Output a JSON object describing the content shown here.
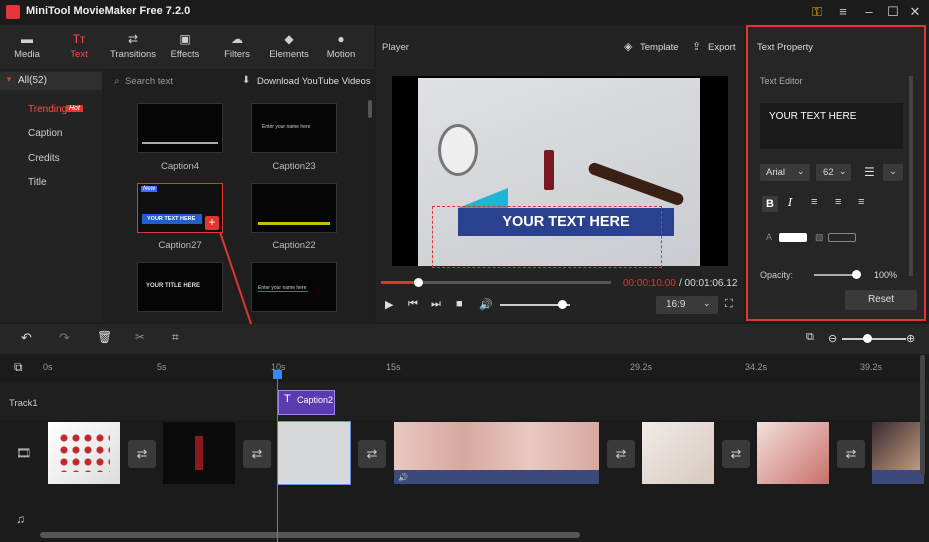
{
  "window": {
    "title": "MiniTool MovieMaker Free 7.2.0",
    "buttons": [
      "key-icon",
      "menu-icon",
      "minimize-icon",
      "maximize-icon",
      "close-icon"
    ]
  },
  "toolbar": {
    "items": [
      {
        "label": "Media",
        "icon": "folder-icon"
      },
      {
        "label": "Text",
        "icon": "text-icon"
      },
      {
        "label": "Transitions",
        "icon": "transitions-icon"
      },
      {
        "label": "Effects",
        "icon": "effects-icon"
      },
      {
        "label": "Filters",
        "icon": "filters-icon"
      },
      {
        "label": "Elements",
        "icon": "elements-icon"
      },
      {
        "label": "Motion",
        "icon": "motion-icon"
      }
    ],
    "active": "Text"
  },
  "sidebar": {
    "all_label": "All(52)",
    "items": [
      {
        "label": "Trending",
        "badge": "Hot"
      },
      {
        "label": "Caption"
      },
      {
        "label": "Credits"
      },
      {
        "label": "Title"
      }
    ]
  },
  "library": {
    "search_placeholder": "Search text",
    "download_label": "Download YouTube Videos",
    "items": [
      {
        "label": "Caption4",
        "preview": ""
      },
      {
        "label": "Caption23",
        "preview": "Enter your name here"
      },
      {
        "label": "Caption27",
        "preview": "YOUR TEXT HERE",
        "badge": "New"
      },
      {
        "label": "Caption22",
        "preview": ""
      },
      {
        "label": "",
        "preview": "YOUR TITLE HERE"
      },
      {
        "label": "",
        "preview": "Enter your name here"
      }
    ]
  },
  "player": {
    "title": "Player",
    "template_label": "Template",
    "export_label": "Export",
    "overlay_text": "YOUR TEXT HERE",
    "current_time": "00:00:10.00",
    "total_time": "/ 00:01:06.12",
    "aspect": "16:9",
    "progress": 0.16,
    "volume": 0.88
  },
  "text_property": {
    "title": "Text Property",
    "editor_label": "Text Editor",
    "text_value": "YOUR TEXT HERE",
    "font": "Arial",
    "size": "62",
    "opacity_label": "Opacity:",
    "opacity_value": "100%",
    "reset_label": "Reset",
    "opacity": 1.0
  },
  "timeline": {
    "ruler": [
      "0s",
      "5s",
      "10s",
      "15s",
      "29.2s",
      "34.2s",
      "39.2s"
    ],
    "track1_label": "Track1",
    "caption_clip": "Caption2"
  },
  "colors": {
    "accent": "#e0362f",
    "caption_clip": "#5b3bb0",
    "player_blue": "#1f5fcf"
  }
}
